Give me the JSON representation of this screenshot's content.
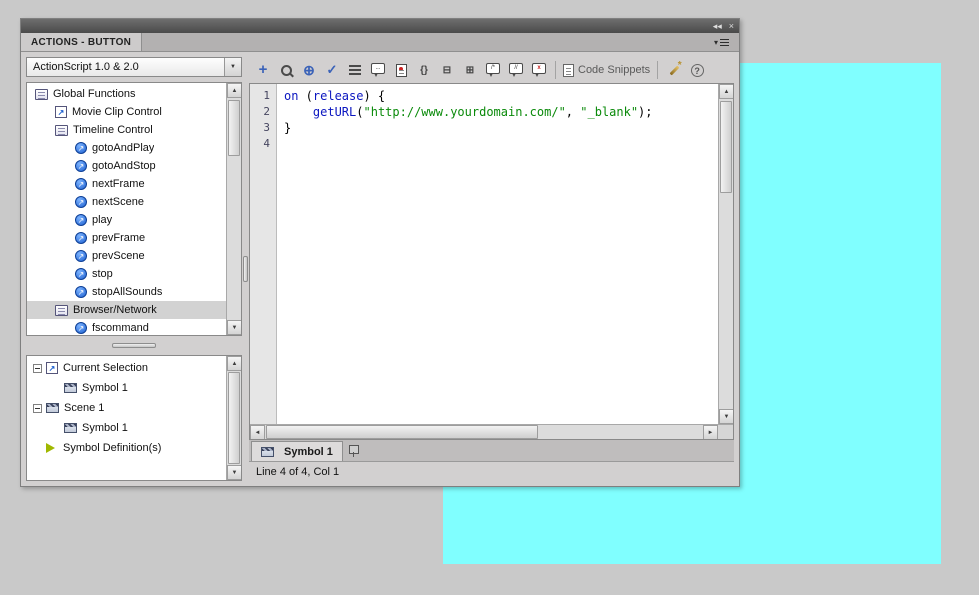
{
  "colors": {
    "stage_fill": "#80ffff",
    "syntax_keyword": "#0b16c0",
    "syntax_string": "#0a8a0a",
    "tree_selection": "#d2d2d2"
  },
  "panel": {
    "tab_title": "ACTIONS - BUTTON",
    "titlebar_icons": [
      {
        "name": "collapse-panel-icon",
        "glyph": "◂◂"
      },
      {
        "name": "close-icon",
        "glyph": "×"
      }
    ]
  },
  "icons": {
    "up": "▲",
    "down": "▼",
    "left": "◄",
    "right": "►",
    "dropdown": "▼"
  },
  "dropdown": {
    "value": "ActionScript 1.0 & 2.0"
  },
  "toolbar": {
    "items": [
      {
        "id": "add-item",
        "glyph": "+"
      },
      {
        "id": "find"
      },
      {
        "id": "insert-target-path",
        "glyph": "⊕"
      },
      {
        "id": "check-syntax",
        "glyph": "✓"
      },
      {
        "id": "auto-format"
      },
      {
        "id": "show-code-hint"
      },
      {
        "id": "debug-options"
      },
      {
        "id": "collapse-between-braces",
        "glyph": "{}"
      },
      {
        "id": "collapse-selection",
        "glyph": "⊟"
      },
      {
        "id": "expand-all",
        "glyph": "⊞"
      },
      {
        "id": "apply-block-comment"
      },
      {
        "id": "apply-line-comment"
      },
      {
        "id": "remove-comment"
      },
      {
        "id": "separator"
      },
      {
        "id": "code-snippets",
        "label": "Code Snippets"
      },
      {
        "id": "separator"
      },
      {
        "id": "wand"
      },
      {
        "id": "help",
        "glyph": "?"
      }
    ]
  },
  "functions_tree": {
    "items": [
      {
        "label": "Global Functions",
        "icon": "book",
        "indent": 0
      },
      {
        "label": "Movie Clip Control",
        "icon": "page",
        "indent": 1
      },
      {
        "label": "Timeline Control",
        "icon": "book",
        "indent": 1
      },
      {
        "label": "gotoAndPlay",
        "icon": "action",
        "indent": 2
      },
      {
        "label": "gotoAndStop",
        "icon": "action",
        "indent": 2
      },
      {
        "label": "nextFrame",
        "icon": "action",
        "indent": 2
      },
      {
        "label": "nextScene",
        "icon": "action",
        "indent": 2
      },
      {
        "label": "play",
        "icon": "action",
        "indent": 2
      },
      {
        "label": "prevFrame",
        "icon": "action",
        "indent": 2
      },
      {
        "label": "prevScene",
        "icon": "action",
        "indent": 2
      },
      {
        "label": "stop",
        "icon": "action",
        "indent": 2
      },
      {
        "label": "stopAllSounds",
        "icon": "action",
        "indent": 2
      },
      {
        "label": "Browser/Network",
        "icon": "book",
        "indent": 1,
        "selected": true
      },
      {
        "label": "fscommand",
        "icon": "action",
        "indent": 2
      }
    ]
  },
  "script_navigator": {
    "items": [
      {
        "label": "Current Selection",
        "icon": "page",
        "indent": 0,
        "expander": true
      },
      {
        "label": "Symbol 1",
        "icon": "clapper",
        "indent": 1
      },
      {
        "label": "Scene 1",
        "icon": "clapper",
        "indent": 0,
        "expander": true
      },
      {
        "label": "Symbol 1",
        "icon": "clapper",
        "indent": 1
      },
      {
        "label": "Symbol Definition(s)",
        "icon": "symdef",
        "indent": 0
      }
    ]
  },
  "editor": {
    "line_numbers": [
      1,
      2,
      3,
      4
    ],
    "lines": [
      [
        {
          "text": "on",
          "type": "keyword"
        },
        {
          "text": " (",
          "type": "plain"
        },
        {
          "text": "release",
          "type": "keyword"
        },
        {
          "text": ") {",
          "type": "plain"
        }
      ],
      [
        {
          "text": "    ",
          "type": "plain"
        },
        {
          "text": "getURL",
          "type": "keyword"
        },
        {
          "text": "(",
          "type": "plain"
        },
        {
          "text": "\"http://www.yourdomain.com/\"",
          "type": "string"
        },
        {
          "text": ", ",
          "type": "plain"
        },
        {
          "text": "\"_blank\"",
          "type": "string"
        },
        {
          "text": ");",
          "type": "plain"
        }
      ],
      [
        {
          "text": "}",
          "type": "plain"
        }
      ],
      []
    ]
  },
  "script_tab": {
    "label": "Symbol 1"
  },
  "status_bar": {
    "text": "Line 4 of 4, Col 1"
  }
}
